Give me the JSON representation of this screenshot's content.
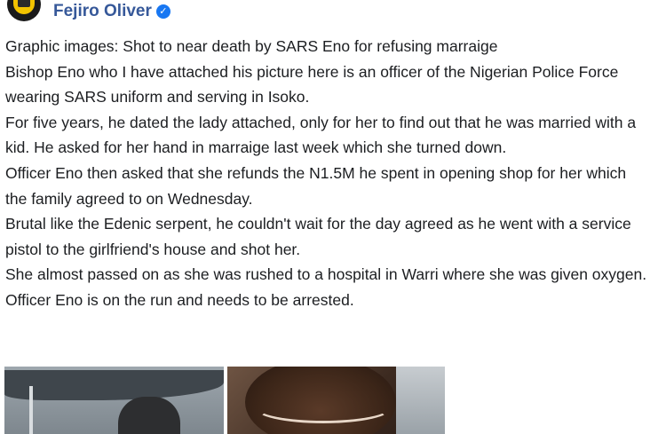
{
  "post": {
    "author": "Fejiro Oliver",
    "verified_glyph": "✓",
    "paragraphs": [
      "Graphic images: Shot to near death by SARS Eno for refusing marraige",
      "Bishop Eno who I have attached his picture here is an officer of the Nigerian Police Force wearing SARS uniform and serving in Isoko.",
      "For five years, he dated the lady attached, only for her to find out that he was married with a kid. He asked for her hand in marraige last week which she turned down.",
      "Officer Eno then asked that she refunds the N1.5M he spent in opening shop for her which the family agreed to on Wednesday.",
      "Brutal like the Edenic serpent, he couldn't wait for the day agreed as he went with a service pistol to the girlfriend's house and shot her.",
      "She almost passed on as she was rushed to a hospital in Warri where she was given oxygen.",
      "Officer Eno is on the run and needs to be arrested."
    ]
  },
  "colors": {
    "author_name": "#365899",
    "verified_badge": "#1877f2",
    "body_text": "#1c1e21"
  },
  "icons": {
    "verified": "verified-badge-icon",
    "avatar": "police-badge-avatar"
  }
}
